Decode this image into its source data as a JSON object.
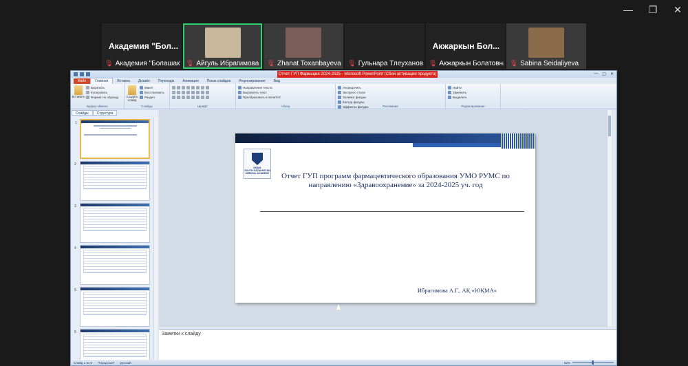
{
  "participants": [
    {
      "big_name": "Академия \"Бол...",
      "label": "Академия \"Болашак\"...",
      "video": false
    },
    {
      "big_name": "",
      "label": "Айгуль Ибрагимова",
      "video": true,
      "active": true,
      "photo_color": "#c9b79b"
    },
    {
      "big_name": "",
      "label": "Zhanat Toxanbayeva ...",
      "video": true,
      "photo_color": "#7a5d58"
    },
    {
      "big_name": "",
      "label": "Гульнара Тлеуханов...",
      "video": false
    },
    {
      "big_name": "Акжаркын Бол...",
      "label": "Акжаркын Болатовна",
      "video": false
    },
    {
      "big_name": "",
      "label": "Sabina Seidaliyeva",
      "video": true,
      "photo_color": "#8a6b4a"
    }
  ],
  "ppt": {
    "title": "Отчет ГУП Фармация 2024-2025 - Microsoft PowerPoint (Сбой активации продукта)",
    "tabs": [
      "Файл",
      "Главная",
      "Вставка",
      "Дизайн",
      "Переходы",
      "Анимация",
      "Показ слайдов",
      "Рецензирование",
      "Вид"
    ],
    "ribbon_groups": [
      {
        "name": "Буфер обмена",
        "items": [
          "Вырезать",
          "Копировать",
          "Формат по образцу"
        ],
        "big": "Вставить"
      },
      {
        "name": "Слайды",
        "items": [
          "Макет",
          "Восстановить",
          "Раздел"
        ],
        "big": "Создать слайд"
      },
      {
        "name": "Шрифт",
        "items": []
      },
      {
        "name": "Абзац",
        "items": [
          "Направление текста",
          "Выровнять текст",
          "Преобразовать в SmartArt"
        ]
      },
      {
        "name": "Рисование",
        "items": [
          "Упорядочить",
          "Экспресс-стили",
          "Заливка фигуры",
          "Контур фигуры",
          "Эффекты фигуры"
        ]
      },
      {
        "name": "Редактирование",
        "items": [
          "Найти",
          "Заменить",
          "Выделить"
        ]
      }
    ],
    "left_tabs": [
      "Слайды",
      "Структура"
    ],
    "slide_numbers": [
      "1",
      "2",
      "3",
      "4",
      "5",
      "6"
    ],
    "slide": {
      "title": "Отчет ГУП программ фармацевтического образования УМО РУМС по направлению «Здравоохранение» за 2024-2025 уч. год",
      "author": "Ибрагимова А.Г., АҚ «ЮҚМА»",
      "logo_text": "SOUTH KAZAKHSTAN MEDICAL ACADEMY",
      "logo_abbr": "ЮҚМА"
    },
    "notes_placeholder": "Заметки к слайду",
    "status": {
      "slide": "Слайд 1 из 6",
      "theme": "\"Городская\"",
      "lang": "русский",
      "zoom": "62%"
    }
  }
}
